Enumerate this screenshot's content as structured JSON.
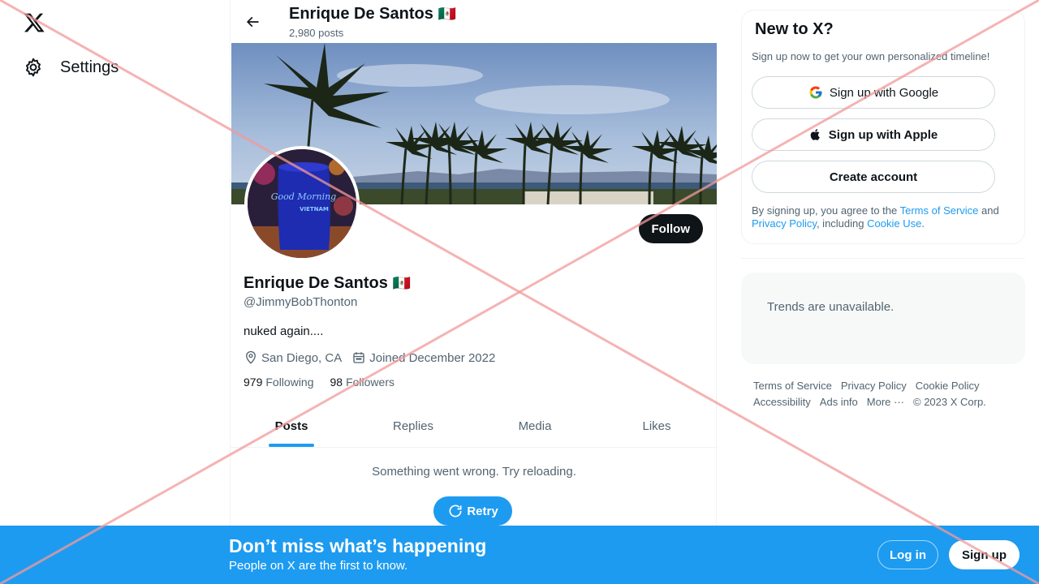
{
  "nav": {
    "settings_label": "Settings"
  },
  "header": {
    "name": "Enrique De Santos",
    "flag": "🇲🇽",
    "post_count": "2,980 posts"
  },
  "profile": {
    "follow_label": "Follow",
    "name": "Enrique De Santos",
    "flag": "🇲🇽",
    "handle": "@JimmyBobThonton",
    "bio": "nuked again....",
    "location": "San Diego, CA",
    "joined": "Joined December 2022",
    "following_count": "979",
    "following_label": "Following",
    "followers_count": "98",
    "followers_label": "Followers",
    "avatar_text_line1": "Good Morning",
    "avatar_text_line2": "VIETNAM"
  },
  "tabs": [
    {
      "label": "Posts",
      "active": true
    },
    {
      "label": "Replies",
      "active": false
    },
    {
      "label": "Media",
      "active": false
    },
    {
      "label": "Likes",
      "active": false
    }
  ],
  "feed": {
    "error_text": "Something went wrong. Try reloading.",
    "retry_label": "Retry"
  },
  "signup_card": {
    "title": "New to X?",
    "subtitle": "Sign up now to get your own personalized timeline!",
    "google_label": "Sign up with Google",
    "apple_label": "Sign up with Apple",
    "create_label": "Create account",
    "legal_prefix": "By signing up, you agree to the ",
    "terms_link": "Terms of Service",
    "legal_and": " and ",
    "privacy_link": "Privacy Policy",
    "legal_including": ", including ",
    "cookie_link": "Cookie Use",
    "legal_end": "."
  },
  "trends": {
    "text": "Trends are unavailable."
  },
  "footer": {
    "terms": "Terms of Service",
    "privacy": "Privacy Policy",
    "cookie": "Cookie Policy",
    "accessibility": "Accessibility",
    "ads": "Ads info",
    "more": "More ···",
    "copyright": "© 2023 X Corp."
  },
  "bottom_bar": {
    "title": "Don’t miss what’s happening",
    "subtitle": "People on X are the first to know.",
    "login_label": "Log in",
    "signup_label": "Sign up"
  },
  "colors": {
    "accent": "#1d9bf0",
    "text_primary": "#0f1419",
    "text_secondary": "#536471",
    "overlay_x": "#f8b6b6"
  }
}
